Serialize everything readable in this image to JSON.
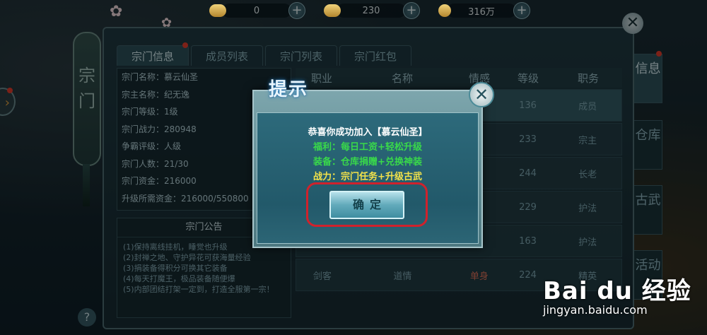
{
  "resources": [
    {
      "value": "0",
      "plus": "+"
    },
    {
      "value": "230",
      "plus": "+"
    },
    {
      "value": "316万",
      "plus": "+"
    }
  ],
  "sect_scroll": "宗门",
  "tabs": [
    "宗门信息",
    "成员列表",
    "宗门列表",
    "宗门红包"
  ],
  "info_rows": [
    "宗门名称：慕云仙圣",
    "宗主名称：纪无逸",
    "宗门等级：1级",
    "宗门战力：280948",
    "争霸评级：人级",
    "宗门人数：21/30",
    "宗门资金：216000",
    "升级所需资金：216000/550800"
  ],
  "notice": {
    "title": "宗门公告",
    "lines": [
      "(1)保持离线挂机，睡觉也升级",
      "(2)封禅之地、守护异花可获海量经验",
      "(3)捐装备得积分可换其它装备",
      "(4)每天打魔王，极品装备随便爆",
      "(5)内部团结打架一定到，打造全服第一宗！"
    ]
  },
  "help": "?",
  "table": {
    "headers": [
      "职业",
      "名称",
      "情感",
      "等级",
      "职务"
    ],
    "rows": [
      {
        "cls": "",
        "name": "",
        "emo": "",
        "level": "136",
        "role": "成员"
      },
      {
        "cls": "",
        "name": "",
        "emo": "",
        "level": "233",
        "role": "宗主"
      },
      {
        "cls": "",
        "name": "",
        "emo": "",
        "level": "244",
        "role": "长老"
      },
      {
        "cls": "",
        "name": "",
        "emo": "",
        "level": "229",
        "role": "护法"
      },
      {
        "cls": "",
        "name": "",
        "emo": "",
        "level": "163",
        "role": "护法"
      },
      {
        "cls": "剑客",
        "name": "道情",
        "emo": "单身",
        "level": "224",
        "role": "精英"
      }
    ]
  },
  "side_tabs": [
    "信息",
    "仓库",
    "古武",
    "活动"
  ],
  "dialog": {
    "title": "提示",
    "close": "✕",
    "line1": "恭喜你成功加入【慕云仙圣】",
    "line2": "福利：每日工资+轻松升级",
    "line3": "装备：仓库捐赠+兑换神装",
    "line4": "战力：宗门任务+升级古武",
    "confirm": "确定"
  },
  "watermark": {
    "big": "Bai du 经验",
    "small": "jingyan.baidu.com"
  },
  "colors": {
    "highlight": "#d0222c",
    "msg_white": "#ffffff",
    "msg_green": "#39d94a",
    "msg_yellow": "#f3e24a"
  }
}
